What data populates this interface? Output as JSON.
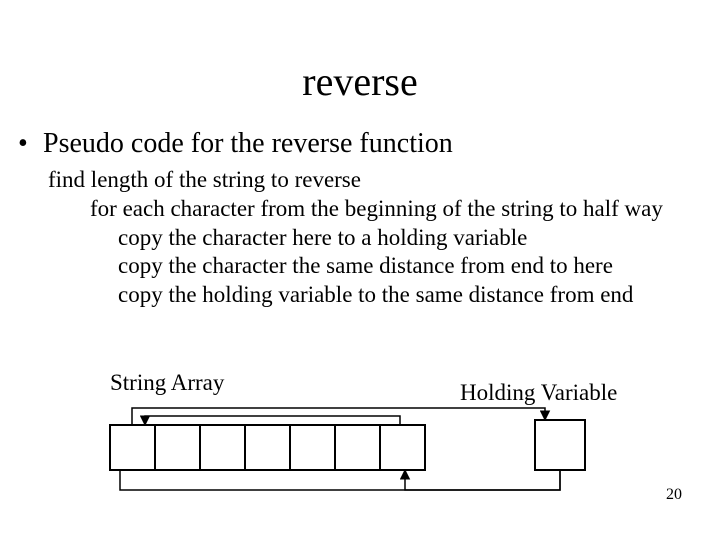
{
  "title": "reverse",
  "bullet": "Pseudo code for the reverse function",
  "pseudo": {
    "l1": "find length of the string to reverse",
    "l2": "for each character from the beginning of the string to half way",
    "l3": "copy the character here to a holding variable",
    "l4": "copy the character the same distance from end to here",
    "l5": "copy the holding variable to the same distance from end"
  },
  "labels": {
    "array": "String Array",
    "holding": "Holding Variable"
  },
  "page_number": "20"
}
